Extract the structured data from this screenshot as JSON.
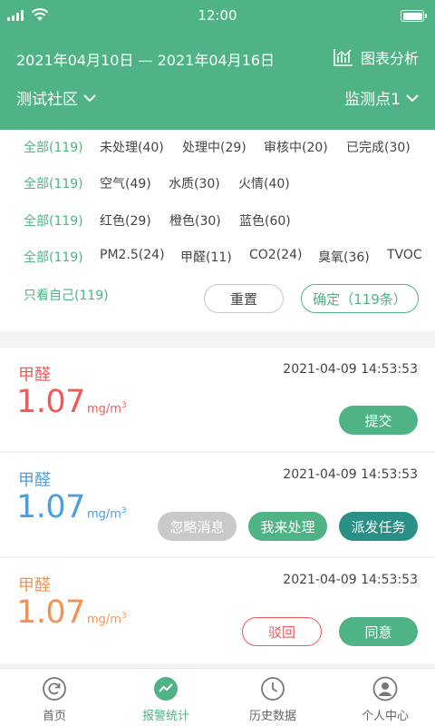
{
  "status": {
    "time": "12:00"
  },
  "header": {
    "date_range": "2021年04月10日 — 2021年04月16日",
    "chart_label": "图表分析",
    "community": "测试社区",
    "monitor_point": "监测点1"
  },
  "filters": {
    "row1": [
      "全部(119)",
      "未处理(40)",
      "处理中(29)",
      "审核中(20)",
      "已完成(30)"
    ],
    "row2": [
      "全部(119)",
      "空气(49)",
      "水质(30)",
      "火情(40)"
    ],
    "row3": [
      "全部(119)",
      "红色(29)",
      "橙色(30)",
      "蓝色(60)"
    ],
    "row4": [
      "全部(119)",
      "PM2.5(24)",
      "甲醛(11)",
      "CO2(24)",
      "臭氧(36)",
      "TVOC"
    ],
    "self_only": "只看自己(119)",
    "reset_label": "重置",
    "confirm_label": "确定（119条）"
  },
  "alerts": [
    {
      "title": "甲醛",
      "value": "1.07",
      "unit": "mg/m",
      "unit_sup": "3",
      "time": "2021-04-09  14:53:53",
      "color": "#f05a5a",
      "actions": [
        "提交"
      ]
    },
    {
      "title": "甲醛",
      "value": "1.07",
      "unit": "mg/m",
      "unit_sup": "3",
      "time": "2021-04-09  14:53:53",
      "color": "#4a9fe0",
      "actions": [
        "忽略消息",
        "我来处理",
        "派发任务"
      ]
    },
    {
      "title": "甲醛",
      "value": "1.07",
      "unit": "mg/m",
      "unit_sup": "3",
      "time": "2021-04-09  14:53:53",
      "color": "#f39353",
      "actions": [
        "驳回",
        "同意"
      ]
    }
  ],
  "tabs": [
    {
      "label": "首页",
      "icon": "home-refresh-icon"
    },
    {
      "label": "报警统计",
      "icon": "trend-icon",
      "active": true
    },
    {
      "label": "历史数据",
      "icon": "clock-icon"
    },
    {
      "label": "个人中心",
      "icon": "user-icon"
    }
  ],
  "colors": {
    "primary": "#4fb385",
    "teal": "#2a8f84",
    "red": "#f05a5a",
    "blue": "#4a9fe0",
    "orange": "#f39353"
  }
}
